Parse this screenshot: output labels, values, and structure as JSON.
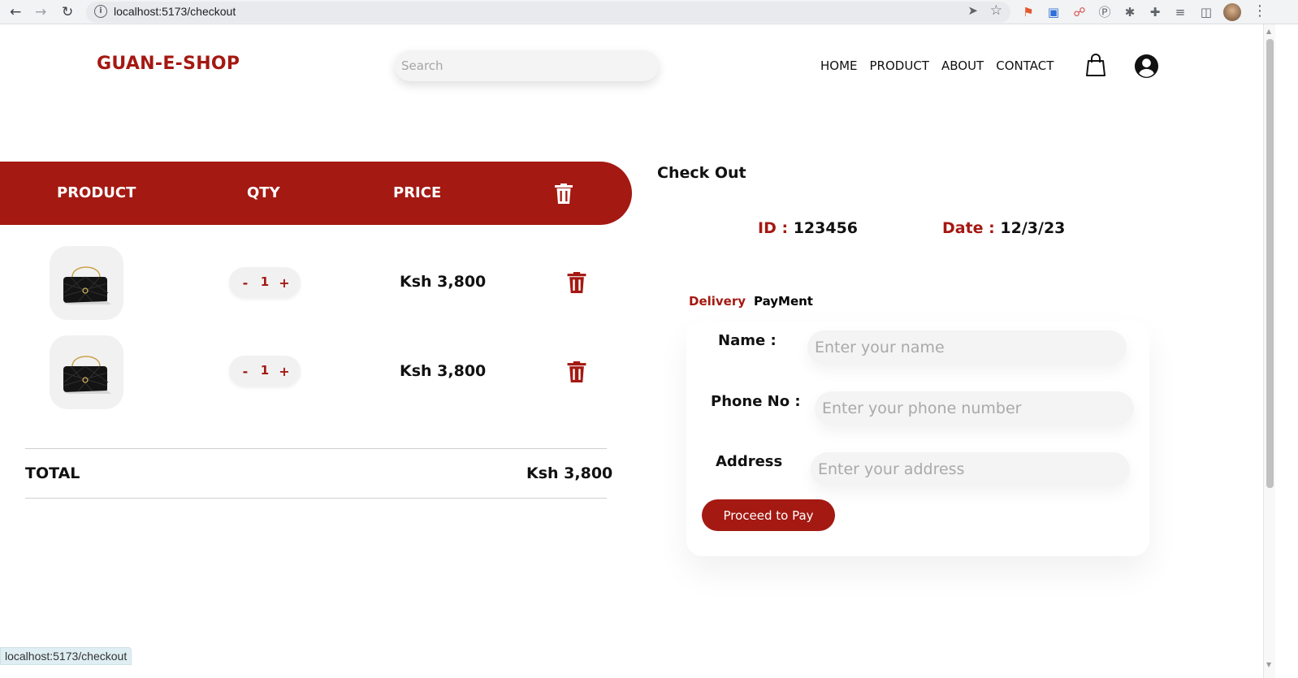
{
  "browser": {
    "url": "localhost:5173/checkout",
    "status_url": "localhost:5173/checkout"
  },
  "header": {
    "logo": "GUAN-E-SHOP",
    "search_placeholder": "Search",
    "nav": [
      "HOME",
      "PRODUCT",
      "ABOUT",
      "CONTACT"
    ],
    "icons": [
      "shopping-bag-icon",
      "user-account-icon"
    ]
  },
  "cart": {
    "columns": {
      "product": "PRODUCT",
      "qty": "QTY",
      "price": "PRICE"
    },
    "items": [
      {
        "qty": "1",
        "price": "Ksh 3,800",
        "minus": "-",
        "plus": "+"
      },
      {
        "qty": "1",
        "price": "Ksh 3,800",
        "minus": "-",
        "plus": "+"
      }
    ],
    "total_label": "TOTAL",
    "total_value": "Ksh 3,800"
  },
  "checkout": {
    "title": "Check Out",
    "id_label": "ID :",
    "id_value": "123456",
    "date_label": "Date :",
    "date_value": "12/3/23",
    "tabs": [
      "Delivery",
      "PayMent"
    ],
    "active_tab": "Delivery",
    "fields": [
      {
        "label": "Name :",
        "placeholder": "Enter your name"
      },
      {
        "label": "Phone No :",
        "placeholder": "Enter your phone number"
      },
      {
        "label": "Address",
        "placeholder": "Enter your address"
      }
    ],
    "submit": "Proceed to Pay"
  },
  "colors": {
    "accent": "#a41912",
    "surface": "#f4f4f4"
  }
}
